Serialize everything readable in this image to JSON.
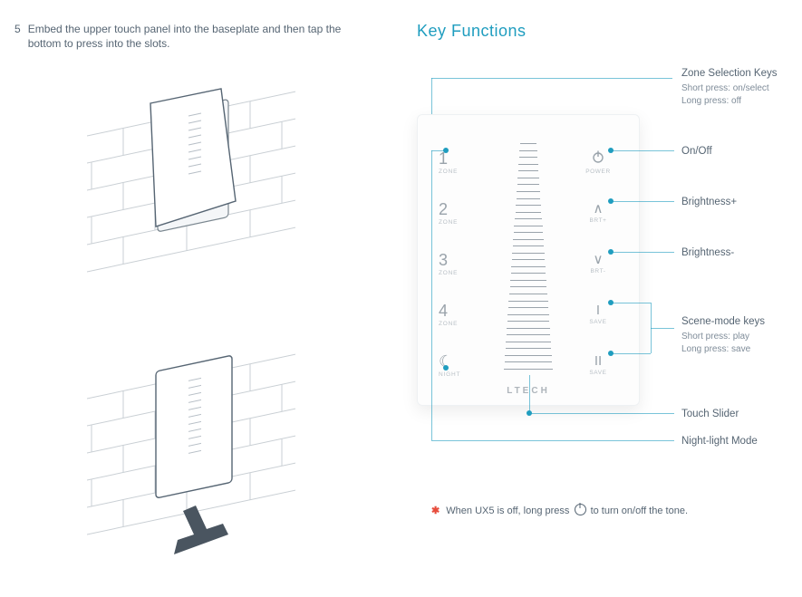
{
  "left": {
    "step_number": "5",
    "step_text": "Embed the upper touch panel into the baseplate and then tap the bottom to press into the slots."
  },
  "right": {
    "title": "Key Functions",
    "panel": {
      "brand": "LTECH",
      "zones": [
        {
          "glyph": "1",
          "sub": "ZONE"
        },
        {
          "glyph": "2",
          "sub": "ZONE"
        },
        {
          "glyph": "3",
          "sub": "ZONE"
        },
        {
          "glyph": "4",
          "sub": "ZONE"
        }
      ],
      "night": {
        "glyph": "☾",
        "sub": "NIGHT"
      },
      "right_keys": {
        "power": {
          "sub": "POWER"
        },
        "brt_up": {
          "glyph": "∧",
          "sub": "BRT+"
        },
        "brt_dn": {
          "glyph": "∨",
          "sub": "BRT-"
        },
        "save1": {
          "glyph": "I",
          "sub": "SAVE"
        },
        "save2": {
          "glyph": "II",
          "sub": "SAVE"
        }
      }
    },
    "labels": {
      "zone": {
        "title": "Zone Selection Keys",
        "sub1": "Short press: on/select",
        "sub2": "Long press: off"
      },
      "power": {
        "title": "On/Off"
      },
      "brt_up": {
        "title": "Brightness+"
      },
      "brt_dn": {
        "title": "Brightness-"
      },
      "scene": {
        "title": "Scene-mode keys",
        "sub1": "Short press: play",
        "sub2": "Long press: save"
      },
      "slider": {
        "title": "Touch Slider"
      },
      "night": {
        "title": "Night-light Mode"
      }
    },
    "note": {
      "asterisk": "✱",
      "pre": "When UX5 is off, long press",
      "post": "to turn on/off the tone."
    }
  }
}
